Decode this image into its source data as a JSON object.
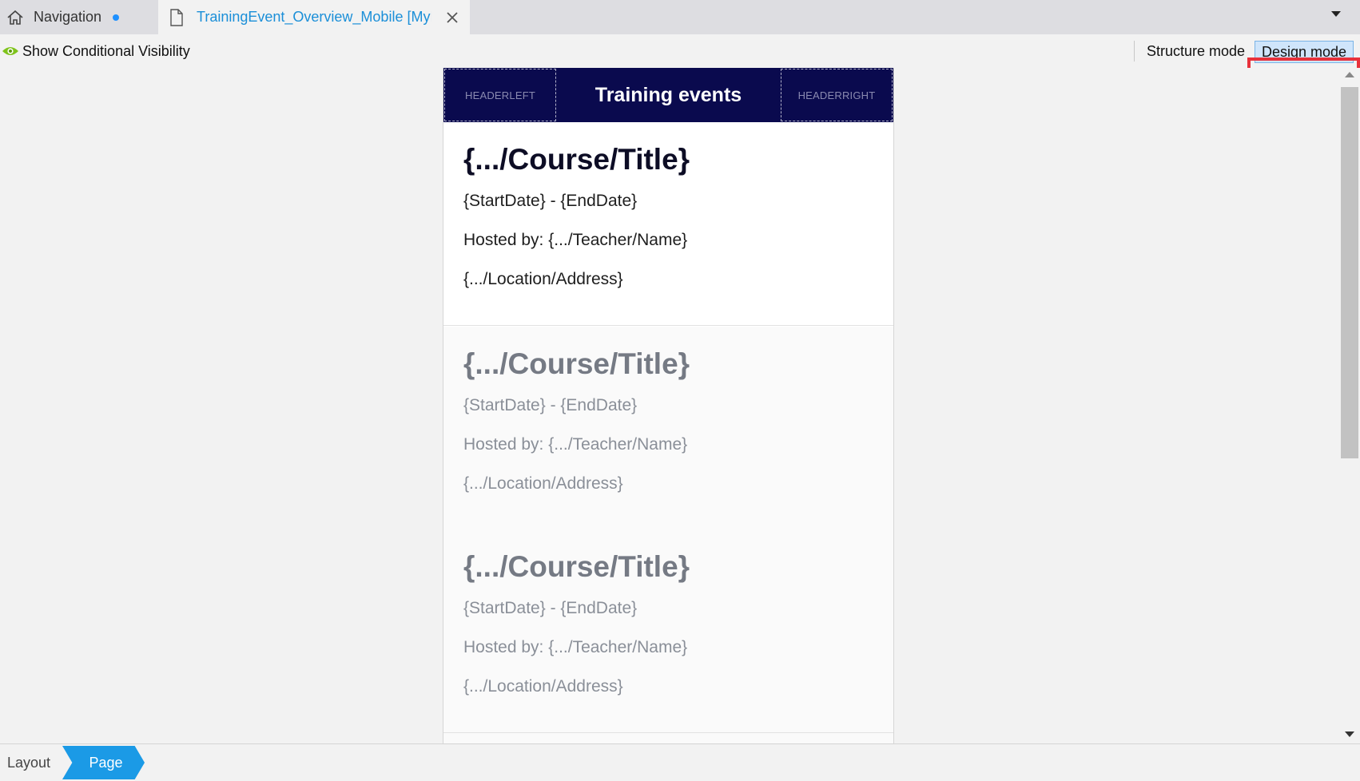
{
  "tabs": {
    "navigation": {
      "label": "Navigation",
      "unsaved": true
    },
    "active": {
      "label": "TrainingEvent_Overview_Mobile [MyF"
    }
  },
  "toolbar": {
    "show_conditional_visibility": "Show Conditional Visibility",
    "structure_mode": "Structure mode",
    "design_mode": "Design mode",
    "selected_mode": "Design mode"
  },
  "page": {
    "header": {
      "left_slot": "HEADERLEFT",
      "title": "Training events",
      "right_slot": "HEADERRIGHT"
    },
    "list_items": [
      {
        "title": "{.../Course/Title}",
        "dates": "{StartDate} - {EndDate}",
        "host": "Hosted by: {.../Teacher/Name}",
        "location": "{.../Location/Address}"
      },
      {
        "title": "{.../Course/Title}",
        "dates": "{StartDate} - {EndDate}",
        "host": "Hosted by: {.../Teacher/Name}",
        "location": "{.../Location/Address}"
      },
      {
        "title": "{.../Course/Title}",
        "dates": "{StartDate} - {EndDate}",
        "host": "Hosted by: {.../Teacher/Name}",
        "location": "{.../Location/Address}"
      }
    ]
  },
  "breadcrumb": {
    "items": [
      "Layout",
      "Page"
    ],
    "active": "Page"
  },
  "colors": {
    "header_bg": "#0a0a4e",
    "accent": "#1b9ae6",
    "highlight": "#e8313b",
    "design_mode_bg": "#cfe5fb"
  },
  "icons": {
    "navigation_tab": "home-icon",
    "active_tab": "document-icon",
    "close": "close-icon",
    "show_cv": "eye-icon"
  }
}
